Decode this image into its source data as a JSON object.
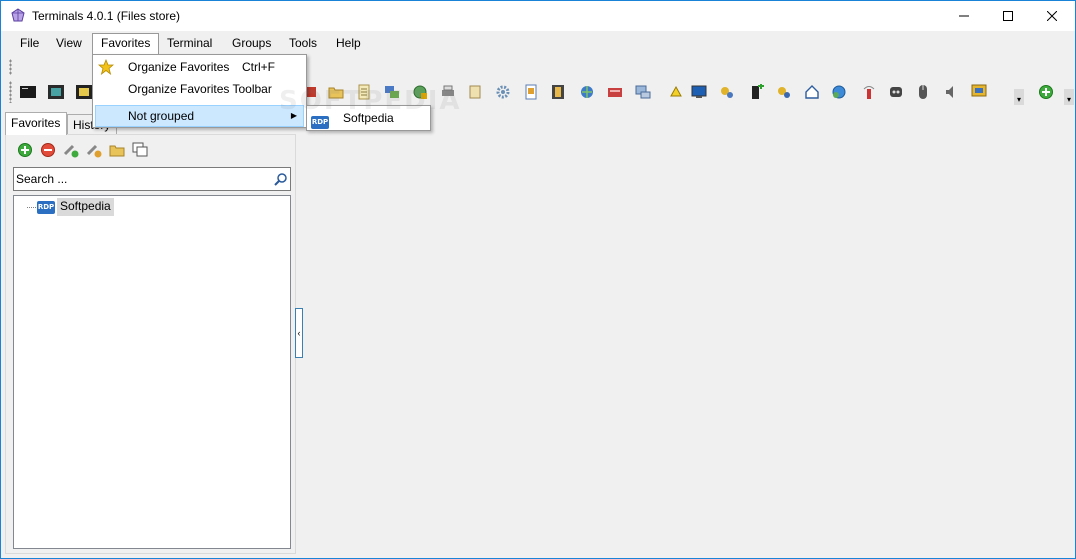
{
  "window": {
    "title": "Terminals 4.0.1 (Files store)"
  },
  "menubar": {
    "items": [
      "File",
      "View",
      "Favorites",
      "Terminal",
      "Groups",
      "Tools",
      "Help"
    ],
    "open_item": "Favorites"
  },
  "favorites_menu": {
    "items": [
      {
        "label": "Organize Favorites",
        "shortcut": "Ctrl+F",
        "icon": "star-icon"
      },
      {
        "label": "Organize Favorites Toolbar",
        "shortcut": "",
        "icon": ""
      },
      {
        "label": "Not grouped",
        "shortcut": "",
        "icon": "",
        "has_submenu": true,
        "highlighted": true
      }
    ]
  },
  "submenu": {
    "items": [
      {
        "label": "Softpedia",
        "icon": "rdp-icon",
        "badge": "RDP"
      }
    ]
  },
  "left_panel": {
    "tabs": [
      "Favorites",
      "History"
    ],
    "active_tab": "Favorites",
    "search_placeholder": "Search ...",
    "tree": [
      {
        "label": "Softpedia",
        "icon": "rdp-icon",
        "badge": "RDP",
        "selected": true
      }
    ]
  },
  "watermark": "SOFTPEDIA"
}
